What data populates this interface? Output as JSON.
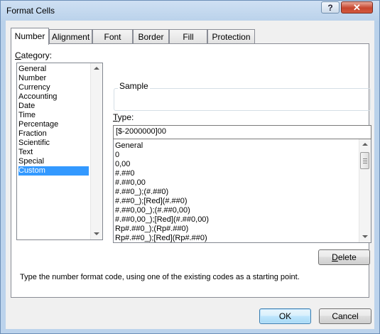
{
  "window": {
    "title": "Format Cells",
    "help_label": "?",
    "close_label": "✕"
  },
  "tabs": [
    {
      "label": "Number",
      "active": true
    },
    {
      "label": "Alignment",
      "active": false
    },
    {
      "label": "Font",
      "active": false
    },
    {
      "label": "Border",
      "active": false
    },
    {
      "label": "Fill",
      "active": false
    },
    {
      "label": "Protection",
      "active": false
    }
  ],
  "category": {
    "label": "Category:",
    "accel": "C",
    "items": [
      "General",
      "Number",
      "Currency",
      "Accounting",
      "Date",
      "Time",
      "Percentage",
      "Fraction",
      "Scientific",
      "Text",
      "Special",
      "Custom"
    ],
    "selected": "Custom"
  },
  "sample": {
    "label": "Sample",
    "value": ""
  },
  "type": {
    "label": "Type:",
    "accel": "T",
    "value": "[$-2000000]00",
    "options": [
      "General",
      "0",
      "0,00",
      "#.##0",
      "#.##0,00",
      "#.##0_);(#.##0)",
      "#.##0_);[Red](#.##0)",
      "#.##0,00_);(#.##0,00)",
      "#.##0,00_);[Red](#.##0,00)",
      "Rp#.##0_);(Rp#.##0)",
      "Rp#.##0_);[Red](Rp#.##0)"
    ]
  },
  "buttons": {
    "delete": "Delete",
    "delete_accel": "D",
    "ok": "OK",
    "cancel": "Cancel"
  },
  "description": "Type the number format code, using one of the existing codes as a starting point.",
  "colors": {
    "selection": "#3399ff",
    "frame": "#b9d1ea",
    "close": "#c7462f"
  }
}
